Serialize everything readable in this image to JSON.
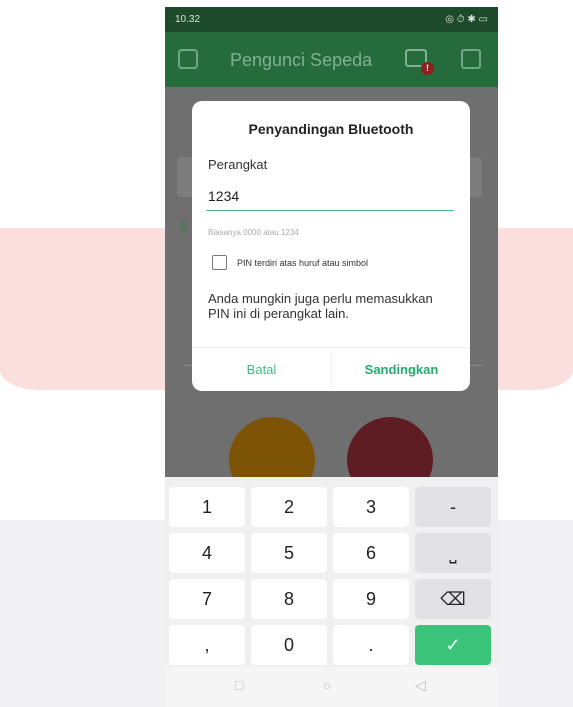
{
  "statusbar": {
    "time": "10.32",
    "signal": "📶",
    "icons": "◎ ⏱ ✱ ▭"
  },
  "appbar": {
    "title": "Pengunci Sepeda",
    "bt_badge": "!"
  },
  "background": {
    "ghost_letter": "S"
  },
  "dialog": {
    "title": "Penyandingan Bluetooth",
    "device_label": "Perangkat",
    "pin_value": "1234",
    "hint": "Biasanya 0000 atau 1234",
    "checkbox_label": "PIN terdiri atas huruf atau simbol",
    "note": "Anda mungkin juga perlu memasukkan PIN ini di perangkat lain.",
    "cancel_label": "Batal",
    "pair_label": "Sandingkan"
  },
  "keyboard": {
    "keys": [
      "1",
      "2",
      "3",
      "-",
      "4",
      "5",
      "6",
      "⎵",
      "7",
      "8",
      "9",
      "⌫",
      ",",
      "0",
      ".",
      "✓"
    ]
  },
  "navbar": {
    "recent": "□",
    "home": "○",
    "back": "◁"
  },
  "colors": {
    "appbar": "#266b3c",
    "accent": "#27a96d",
    "enter": "#3cc37a"
  }
}
